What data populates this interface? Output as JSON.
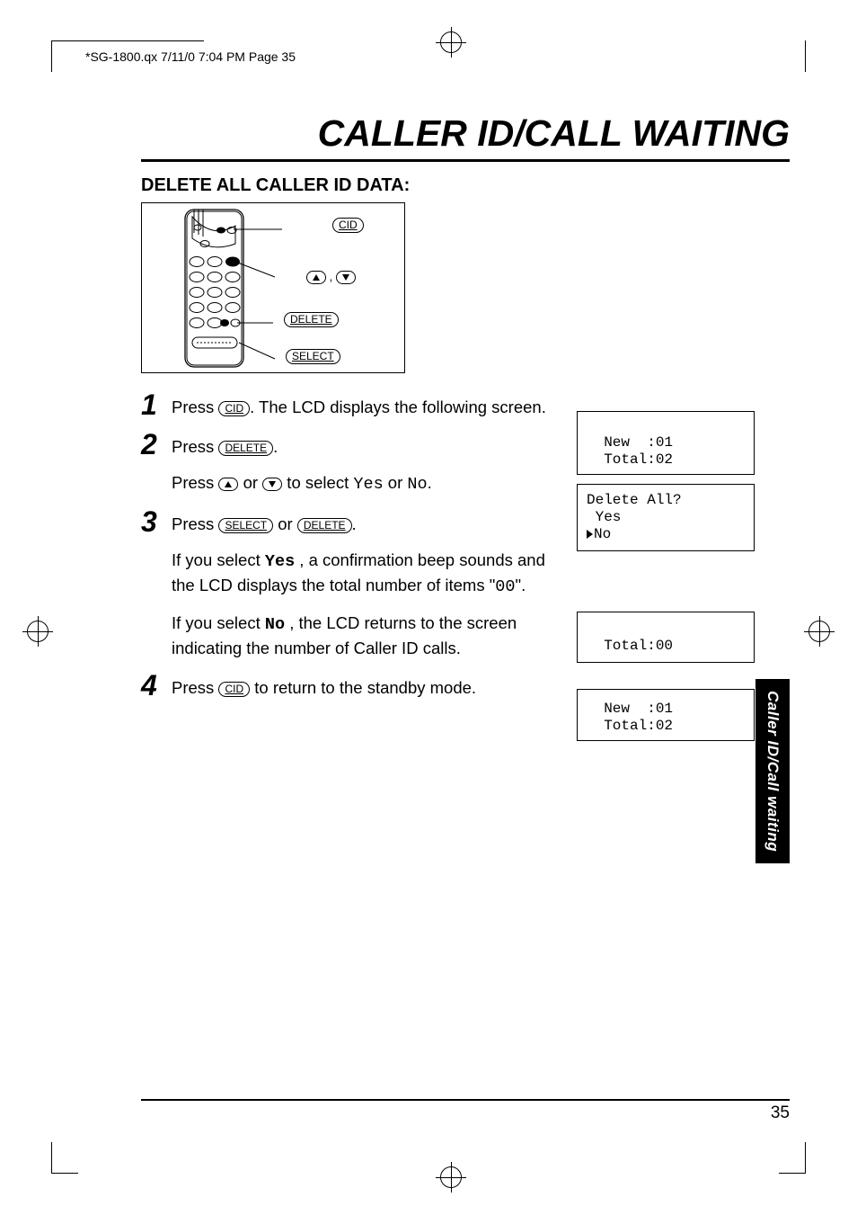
{
  "header": {
    "slug": "*SG-1800.qx  7/11/0 7:04 PM  Page 35"
  },
  "chapter": {
    "title": "CALLER ID/CALL WAITING",
    "section_title": "DELETE ALL CALLER ID DATA:"
  },
  "diagram": {
    "labels": {
      "cid": "CID",
      "delete": "DELETE",
      "select": "SELECT"
    }
  },
  "buttons": {
    "cid": "CID",
    "delete": "DELETE",
    "select": "SELECT"
  },
  "steps": {
    "s1": {
      "num": "1",
      "t1": "Press ",
      "t2": ".  The LCD displays the following screen."
    },
    "s2": {
      "num": "2",
      "t1": "Press ",
      "t2": ".",
      "sub1": "Press ",
      "sub2": " or ",
      "sub3": " to select ",
      "yes": "Yes",
      "or": " or ",
      "no": "No",
      "end": "."
    },
    "s3": {
      "num": "3",
      "t1": "Press ",
      "or": " or ",
      "t2": ".",
      "yes_label": "Yes",
      "yes_text1": "If you select ",
      "yes_text2": " , a confirmation beep sounds and the LCD displays the total number of items \"",
      "zero": "00",
      "yes_text3": "\".",
      "no_label": "No",
      "no_text1": "If you select ",
      "no_text2": " , the LCD returns to the screen indicating the number of Caller ID calls."
    },
    "s4": {
      "num": "4",
      "t1": "Press ",
      "t2": " to return to the standby mode."
    }
  },
  "lcd": {
    "screen1": "  New  :01\n  Total:02",
    "screen2_l1": "Delete All?",
    "screen2_l2": " Yes",
    "screen2_l3": "No",
    "screen3": "  Total:00",
    "screen4": "  New  :01\n  Total:02"
  },
  "side_tab": "Caller ID/Call waiting",
  "page_number": "35"
}
